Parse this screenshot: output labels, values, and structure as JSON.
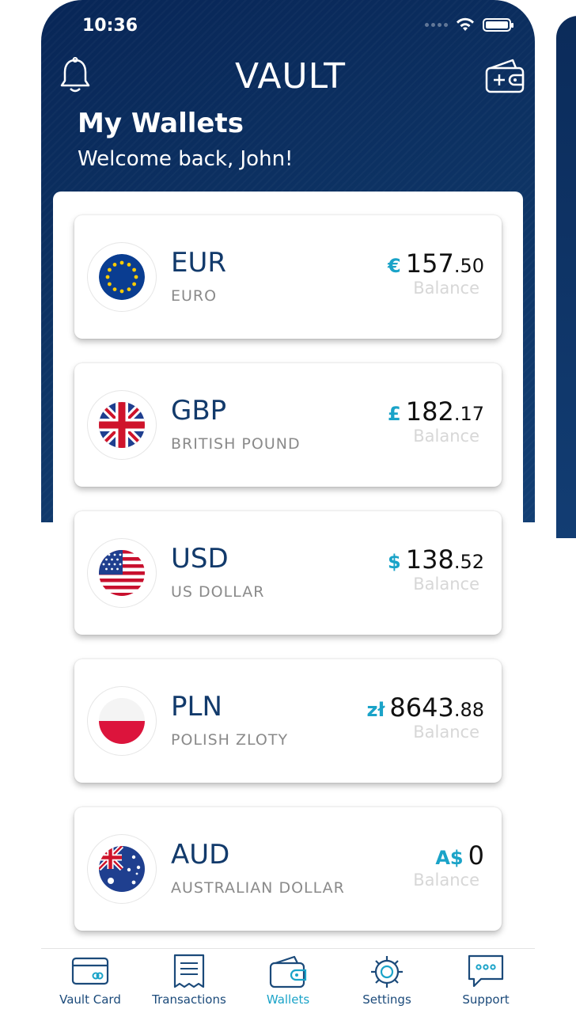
{
  "status_bar": {
    "time": "10:36"
  },
  "header": {
    "logo_text": "VAULT",
    "title": "My Wallets",
    "subtitle": "Welcome back, John!",
    "left_icon": "bell-icon",
    "right_icon": "add-wallet-icon"
  },
  "colors": {
    "navy": "#0b2e5e",
    "accent": "#1aa3c8"
  },
  "wallets": [
    {
      "code": "EUR",
      "name": "EURO",
      "symbol": "€",
      "major": "157",
      "minor": ".50",
      "balance_label": "Balance",
      "flag": "eu-flag-icon"
    },
    {
      "code": "GBP",
      "name": "BRITISH POUND",
      "symbol": "£",
      "major": "182",
      "minor": ".17",
      "balance_label": "Balance",
      "flag": "uk-flag-icon"
    },
    {
      "code": "USD",
      "name": "US DOLLAR",
      "symbol": "$",
      "major": "138",
      "minor": ".52",
      "balance_label": "Balance",
      "flag": "us-flag-icon"
    },
    {
      "code": "PLN",
      "name": "POLISH ZLOTY",
      "symbol": "zł",
      "major": "8643",
      "minor": ".88",
      "balance_label": "Balance",
      "flag": "poland-flag-icon"
    },
    {
      "code": "AUD",
      "name": "AUSTRALIAN DOLLAR",
      "symbol": "A$",
      "major": "0",
      "minor": "",
      "balance_label": "Balance",
      "flag": "australia-flag-icon"
    }
  ],
  "tabs": [
    {
      "label": "Vault Card",
      "icon": "card-icon",
      "active": false
    },
    {
      "label": "Transactions",
      "icon": "receipt-icon",
      "active": false
    },
    {
      "label": "Wallets",
      "icon": "wallet-icon",
      "active": true
    },
    {
      "label": "Settings",
      "icon": "gear-icon",
      "active": false
    },
    {
      "label": "Support",
      "icon": "chat-bubble-icon",
      "active": false
    }
  ]
}
